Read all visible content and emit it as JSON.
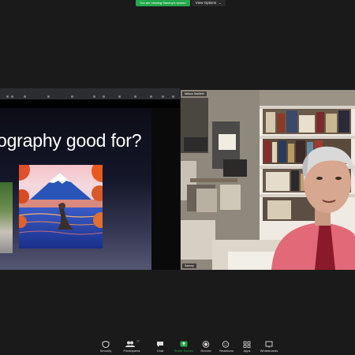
{
  "banner": {
    "share_status": "You are viewing Sammy's screen",
    "view_options": "View Options"
  },
  "shared_screen": {
    "slide_title": "ography good for?"
  },
  "video": {
    "participant_name_top": "Nelson Sanfieth",
    "participant_name_bottom": "Sammy"
  },
  "toolbar": {
    "items": [
      {
        "label": "Security",
        "icon": "shield-icon"
      },
      {
        "label": "Participants",
        "icon": "participants-icon",
        "count": "77"
      },
      {
        "label": "Chat",
        "icon": "chat-icon"
      },
      {
        "label": "Share Screen",
        "icon": "share-screen-icon"
      },
      {
        "label": "Record",
        "icon": "record-icon"
      },
      {
        "label": "Reactions",
        "icon": "reactions-icon"
      },
      {
        "label": "Apps",
        "icon": "apps-icon"
      },
      {
        "label": "Whiteboards",
        "icon": "whiteboard-icon"
      }
    ]
  },
  "colors": {
    "share_green": "#22a84a",
    "background": "#1a1a1a"
  }
}
